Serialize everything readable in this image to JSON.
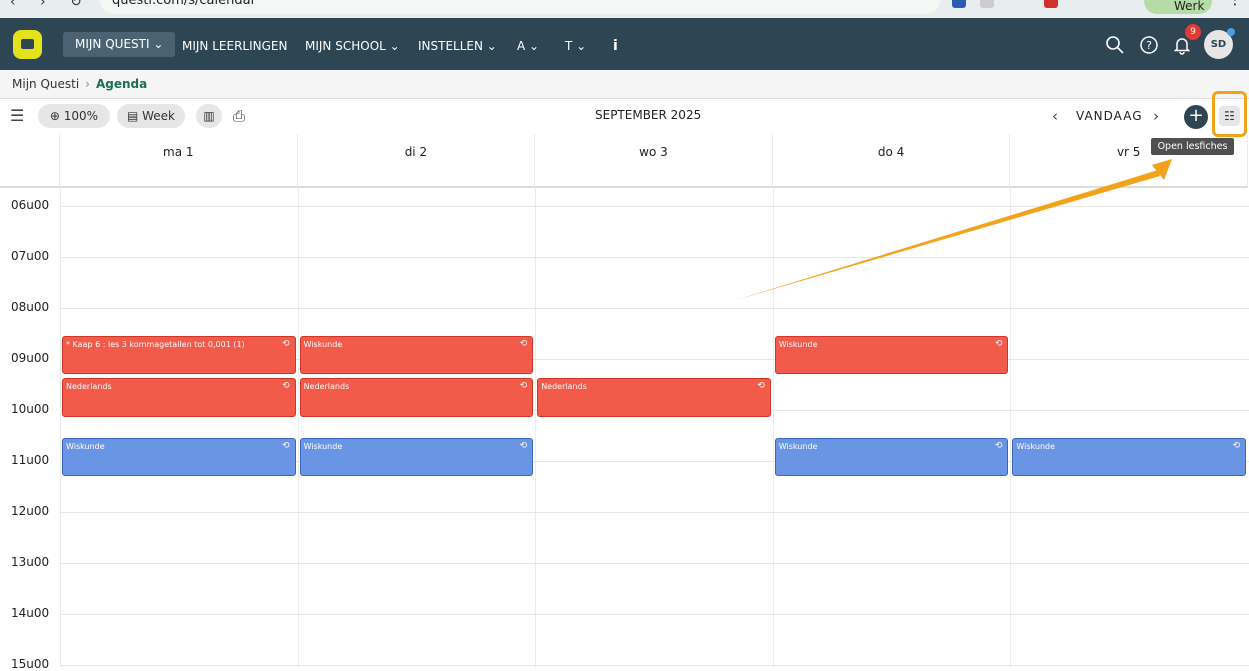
{
  "browser": {
    "url": "questi.com/s/calendar",
    "profile": "Werk"
  },
  "nav": {
    "items": [
      {
        "label": "MIJN QUESTI ⌄",
        "active": true
      },
      {
        "label": "MIJN LEERLINGEN"
      },
      {
        "label": "MIJN SCHOOL ⌄"
      },
      {
        "label": "INSTELLEN ⌄"
      },
      {
        "label": "A ⌄"
      },
      {
        "label": "T ⌄"
      },
      {
        "label": "i"
      }
    ],
    "notifications": "9",
    "avatar": "SD"
  },
  "breadcrumb": {
    "parent": "Mijn Questi",
    "current": "Agenda"
  },
  "toolbar": {
    "zoom": "100%",
    "view": "Week",
    "month": "SEPTEMBER 2025",
    "today": "VANDAAG",
    "tooltip": "Open lesfiches"
  },
  "calendar": {
    "days": [
      "ma 1",
      "di 2",
      "wo 3",
      "do 4",
      "vr 5"
    ],
    "hours": [
      "06u00",
      "07u00",
      "08u00",
      "09u00",
      "10u00",
      "11u00",
      "12u00",
      "13u00",
      "14u00",
      "15u00"
    ],
    "events": [
      {
        "day": 0,
        "title": "* Kaap 6 : les 3 kommagetallen tot 0,001 (1)",
        "start": "08:30",
        "end": "09:20",
        "color": "red"
      },
      {
        "day": 1,
        "title": "Wiskunde",
        "start": "08:30",
        "end": "09:20",
        "color": "red"
      },
      {
        "day": 3,
        "title": "Wiskunde",
        "start": "08:30",
        "end": "09:20",
        "color": "red"
      },
      {
        "day": 0,
        "title": "Nederlands",
        "start": "09:20",
        "end": "10:10",
        "color": "red"
      },
      {
        "day": 1,
        "title": "Nederlands",
        "start": "09:20",
        "end": "10:10",
        "color": "red"
      },
      {
        "day": 2,
        "title": "Nederlands",
        "start": "09:20",
        "end": "10:10",
        "color": "red"
      },
      {
        "day": 0,
        "title": "Wiskunde",
        "start": "10:30",
        "end": "11:20",
        "color": "blue"
      },
      {
        "day": 1,
        "title": "Wiskunde",
        "start": "10:30",
        "end": "11:20",
        "color": "blue"
      },
      {
        "day": 3,
        "title": "Wiskunde",
        "start": "10:30",
        "end": "11:20",
        "color": "blue"
      },
      {
        "day": 4,
        "title": "Wiskunde",
        "start": "10:30",
        "end": "11:20",
        "color": "blue"
      }
    ]
  },
  "colors": {
    "nav_bg": "#2e4553",
    "event_red": "#f25a4a",
    "event_blue": "#6a95e4",
    "highlight": "#f2a21b"
  }
}
